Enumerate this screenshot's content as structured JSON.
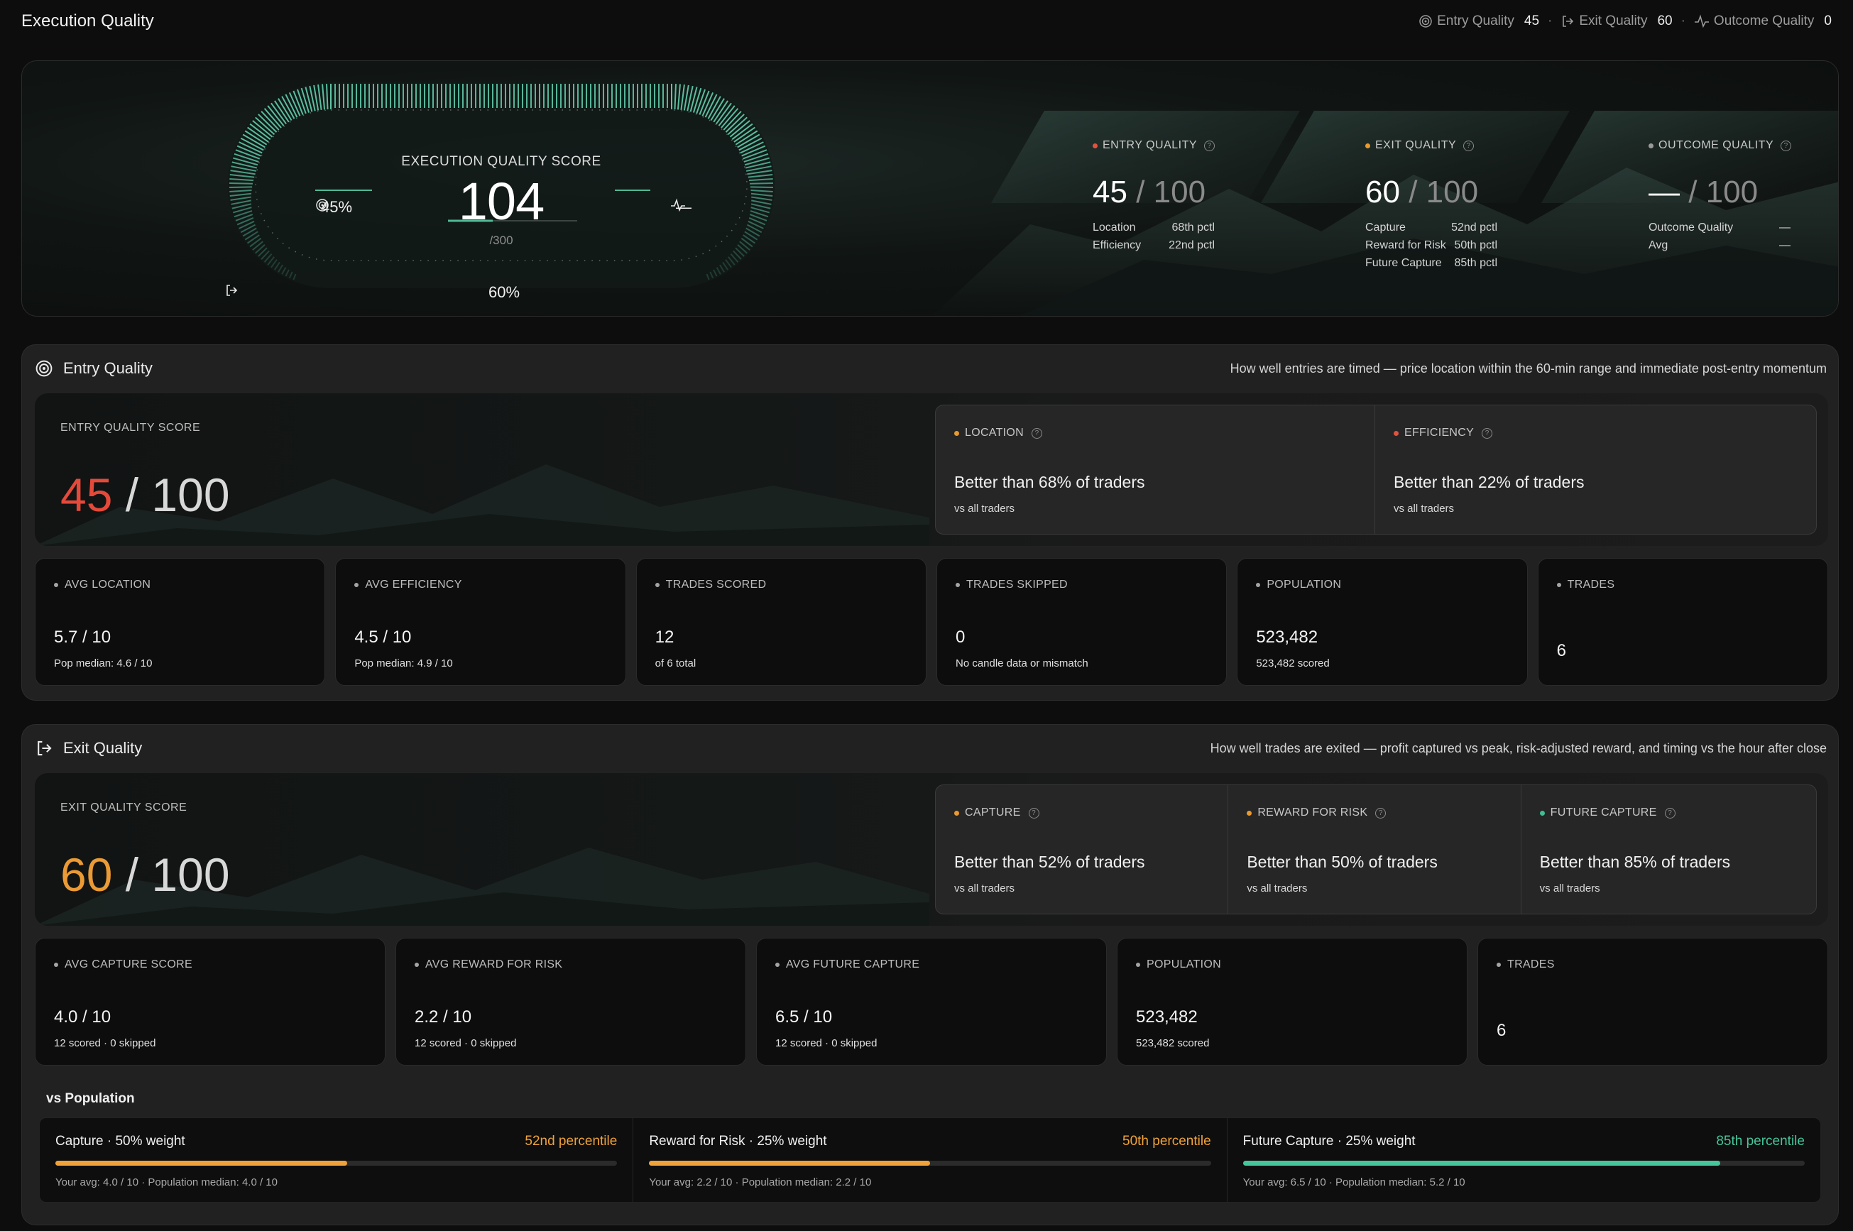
{
  "app": {
    "title": "Execution Quality"
  },
  "topbar": {
    "metrics": [
      {
        "label": "Entry Quality",
        "value": "45",
        "icon": "target-icon"
      },
      {
        "label": "Exit Quality",
        "value": "60",
        "icon": "exit-icon"
      },
      {
        "label": "Outcome Quality",
        "value": "0",
        "icon": "pulse-icon"
      }
    ],
    "separator": "·"
  },
  "hero": {
    "gauge": {
      "label": "EXECUTION QUALITY SCORE",
      "score": "104",
      "max": "/300",
      "left_value": "45%",
      "right_value": "—",
      "bottom_value": "60%"
    },
    "cards": [
      {
        "label": "ENTRY QUALITY",
        "score": "45",
        "den": "/ 100",
        "color": "#e0533f",
        "rows": [
          {
            "k": "Location",
            "v": "68th pctl"
          },
          {
            "k": "Efficiency",
            "v": "22nd pctl"
          }
        ]
      },
      {
        "label": "EXIT QUALITY",
        "score": "60",
        "den": "/ 100",
        "color": "#e9992e",
        "rows": [
          {
            "k": "Capture",
            "v": "52nd pctl"
          },
          {
            "k": "Reward for Risk",
            "v": "50th pctl"
          },
          {
            "k": "Future Capture",
            "v": "85th pctl"
          }
        ]
      },
      {
        "label": "OUTCOME QUALITY",
        "score": "—",
        "den": "/ 100",
        "color": "#9a9a9a",
        "rows": [
          {
            "k": "Outcome Quality",
            "v": "—"
          },
          {
            "k": "Avg",
            "v": "—"
          }
        ]
      }
    ]
  },
  "entry": {
    "title": "Entry Quality",
    "description": "How well entries are timed — price location within the 60-min range and immediate post-entry momentum",
    "score_label": "ENTRY QUALITY SCORE",
    "score": "45",
    "score_den": " / 100",
    "score_color": "#e5493a",
    "subs": [
      {
        "label": "LOCATION",
        "text": "Better than 68% of traders",
        "note": "vs all traders",
        "color": "#e9992e"
      },
      {
        "label": "EFFICIENCY",
        "text": "Better than 22% of traders",
        "note": "vs all traders",
        "color": "#e0533f"
      }
    ],
    "stats": [
      {
        "label": "AVG LOCATION",
        "value": "5.7 / 10",
        "note": "Pop median: 4.6 / 10"
      },
      {
        "label": "AVG EFFICIENCY",
        "value": "4.5 / 10",
        "note": "Pop median: 4.9 / 10"
      },
      {
        "label": "TRADES SCORED",
        "value": "12",
        "note": "of 6 total"
      },
      {
        "label": "TRADES SKIPPED",
        "value": "0",
        "note": "No candle data or mismatch"
      },
      {
        "label": "POPULATION",
        "value": "523,482",
        "note": "523,482 scored"
      },
      {
        "label": "TRADES",
        "value": "6",
        "note": ""
      }
    ]
  },
  "exit": {
    "title": "Exit Quality",
    "description": "How well trades are exited — profit captured vs peak, risk-adjusted reward, and timing vs the hour after close",
    "score_label": "EXIT QUALITY SCORE",
    "score": "60",
    "score_den": " / 100",
    "score_color": "#eb9a35",
    "subs": [
      {
        "label": "CAPTURE",
        "text": "Better than 52% of traders",
        "note": "vs all traders",
        "color": "#e9992e"
      },
      {
        "label": "REWARD FOR RISK",
        "text": "Better than 50% of traders",
        "note": "vs all traders",
        "color": "#e9992e"
      },
      {
        "label": "FUTURE CAPTURE",
        "text": "Better than 85% of traders",
        "note": "vs all traders",
        "color": "#3fbf93"
      }
    ],
    "stats": [
      {
        "label": "AVG CAPTURE SCORE",
        "value": "4.0 / 10",
        "note": "12 scored · 0 skipped"
      },
      {
        "label": "AVG REWARD FOR RISK",
        "value": "2.2 / 10",
        "note": "12 scored · 0 skipped"
      },
      {
        "label": "AVG FUTURE CAPTURE",
        "value": "6.5 / 10",
        "note": "12 scored · 0 skipped"
      },
      {
        "label": "POPULATION",
        "value": "523,482",
        "note": "523,482 scored"
      },
      {
        "label": "TRADES",
        "value": "6",
        "note": ""
      }
    ],
    "vs_title": "vs Population",
    "vs": [
      {
        "name": "Capture · 50% weight",
        "pct_label": "52nd percentile",
        "pct": 52,
        "color": "#f0a23a",
        "note": "Your avg: 4.0 / 10 · Population median: 4.0 / 10"
      },
      {
        "name": "Reward for Risk · 25% weight",
        "pct_label": "50th percentile",
        "pct": 50,
        "color": "#f0a23a",
        "note": "Your avg: 2.2 / 10 · Population median: 2.2 / 10"
      },
      {
        "name": "Future Capture · 25% weight",
        "pct_label": "85th percentile",
        "pct": 85,
        "color": "#45c59b",
        "note": "Your avg: 6.5 / 10 · Population median: 5.2 / 10"
      }
    ]
  },
  "colors": {
    "accent": "#3fbf93",
    "background": "#0d0d0d",
    "panel": "#212121"
  }
}
